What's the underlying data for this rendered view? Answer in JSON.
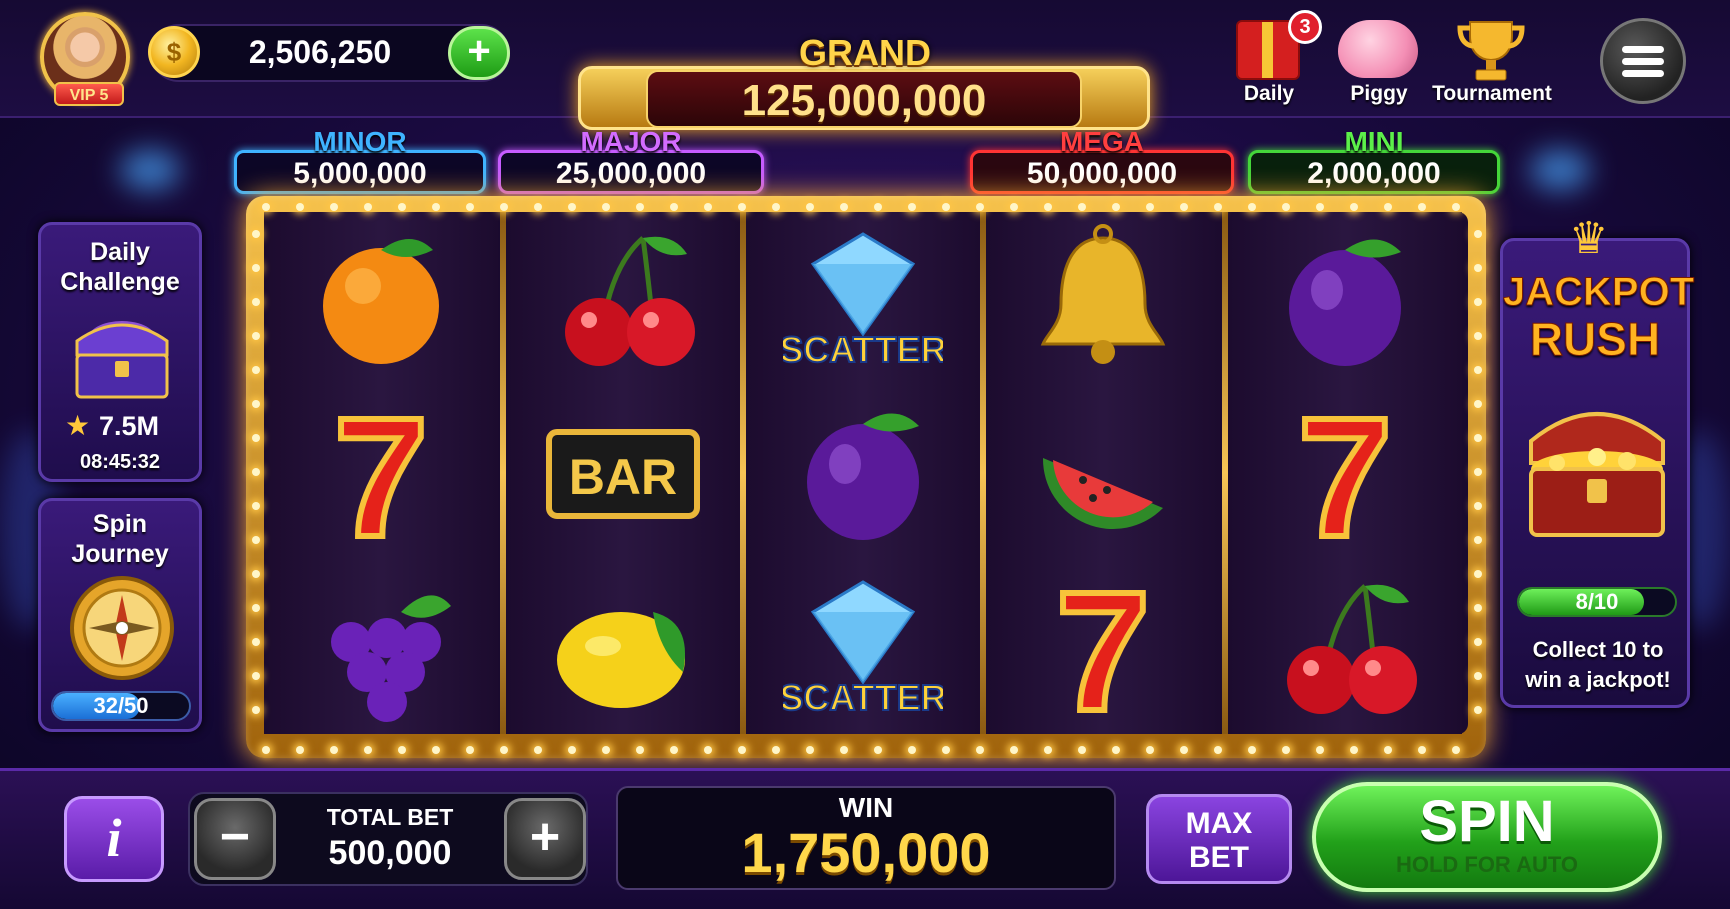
{
  "player": {
    "vip_label": "VIP 5",
    "balance": "2,506,250"
  },
  "jackpots": {
    "grand": {
      "label": "GRAND",
      "value": "125,000,000"
    },
    "minor": {
      "label": "MINOR",
      "value": "5,000,000",
      "color": "#3fb3ff"
    },
    "major": {
      "label": "MAJOR",
      "value": "25,000,000",
      "color": "#d36cff"
    },
    "mega": {
      "label": "MEGA",
      "value": "50,000,000",
      "color": "#ff3f3f"
    },
    "mini": {
      "label": "MINI",
      "value": "2,000,000",
      "color": "#5cf04a"
    }
  },
  "top_icons": {
    "daily": {
      "label": "Daily",
      "badge": "3"
    },
    "piggy": {
      "label": "Piggy"
    },
    "tournament": {
      "label": "Tournament"
    }
  },
  "daily_challenge": {
    "title": "Daily Challenge",
    "reward": "7.5M",
    "timer": "08:45:32"
  },
  "spin_journey": {
    "title": "Spin Journey",
    "progress": "32/50",
    "progress_fraction": 0.64
  },
  "jackpot_rush": {
    "title_line1": "JACKPOT",
    "title_line2": "RUSH",
    "progress": "8/10",
    "progress_fraction": 0.8,
    "description": "Collect 10 to win a jackpot!"
  },
  "reels": [
    [
      "orange-icon",
      "seven-icon",
      "grapes-icon"
    ],
    [
      "cherries-icon",
      "bar-icon",
      "lemon-icon"
    ],
    [
      "scatter-diamond-icon",
      "plum-icon",
      "scatter-diamond-icon"
    ],
    [
      "bell-icon",
      "watermelon-icon",
      "seven-icon"
    ],
    [
      "plum-icon",
      "seven-icon",
      "cherries-icon"
    ]
  ],
  "symbols": {
    "bar_text": "BAR",
    "scatter_text": "SCATTER",
    "seven_text": "7"
  },
  "bet": {
    "label": "TOTAL BET",
    "value": "500,000",
    "minus": "−",
    "plus": "+"
  },
  "win": {
    "label": "WIN",
    "value": "1,750,000"
  },
  "buttons": {
    "info": "i",
    "max_bet_line1": "MAX",
    "max_bet_line2": "BET",
    "spin": "SPIN",
    "spin_sub": "HOLD FOR AUTO",
    "add_coins": "+"
  },
  "colors": {
    "gold": "#ffd44a",
    "spin_green": "#22a11a",
    "panel_purple": "#3a1a7a"
  }
}
